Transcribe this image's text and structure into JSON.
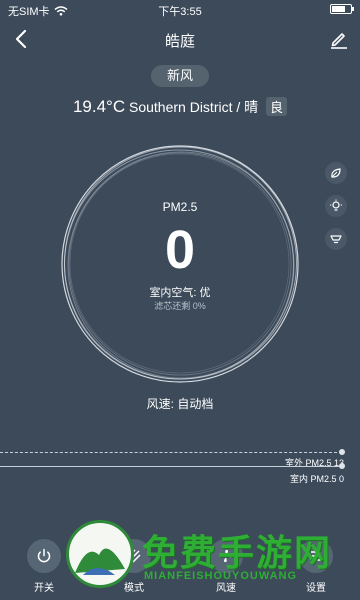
{
  "status_bar": {
    "carrier": "无SIM卡",
    "time": "下午3:55",
    "battery_level": 0.7
  },
  "nav": {
    "title": "皓庭",
    "back_icon": "chevron-left-icon",
    "edit_icon": "pencil-icon"
  },
  "mode": "新风",
  "weather": {
    "temperature": "19.4°C",
    "location_condition": "Southern District / 晴",
    "air_quality": "良"
  },
  "gauge": {
    "label": "PM2.5",
    "value": "0",
    "indoor_air": "室内空气: 优",
    "filter_remaining": "滤芯还剩 0%"
  },
  "side_buttons": [
    "leaf-icon",
    "bulb-icon",
    "lamp-icon"
  ],
  "wind_speed": "风速: 自动档",
  "chart": {
    "outdoor_label": "室外 PM2.5 13",
    "indoor_label": "室内 PM2.5 0"
  },
  "tabs": [
    {
      "label": "开关",
      "icon": "power-icon"
    },
    {
      "label": "模式",
      "icon": "mode-icon"
    },
    {
      "label": "风速",
      "icon": "fan-icon"
    },
    {
      "label": "设置",
      "icon": "settings-icon"
    }
  ],
  "watermark": {
    "title": "免费手游网",
    "subtitle": "MIANFEISHOUYOUWANG"
  },
  "colors": {
    "background": "#3c4a5a",
    "pill": "#55636f",
    "watermark_green": "#2eae34"
  }
}
